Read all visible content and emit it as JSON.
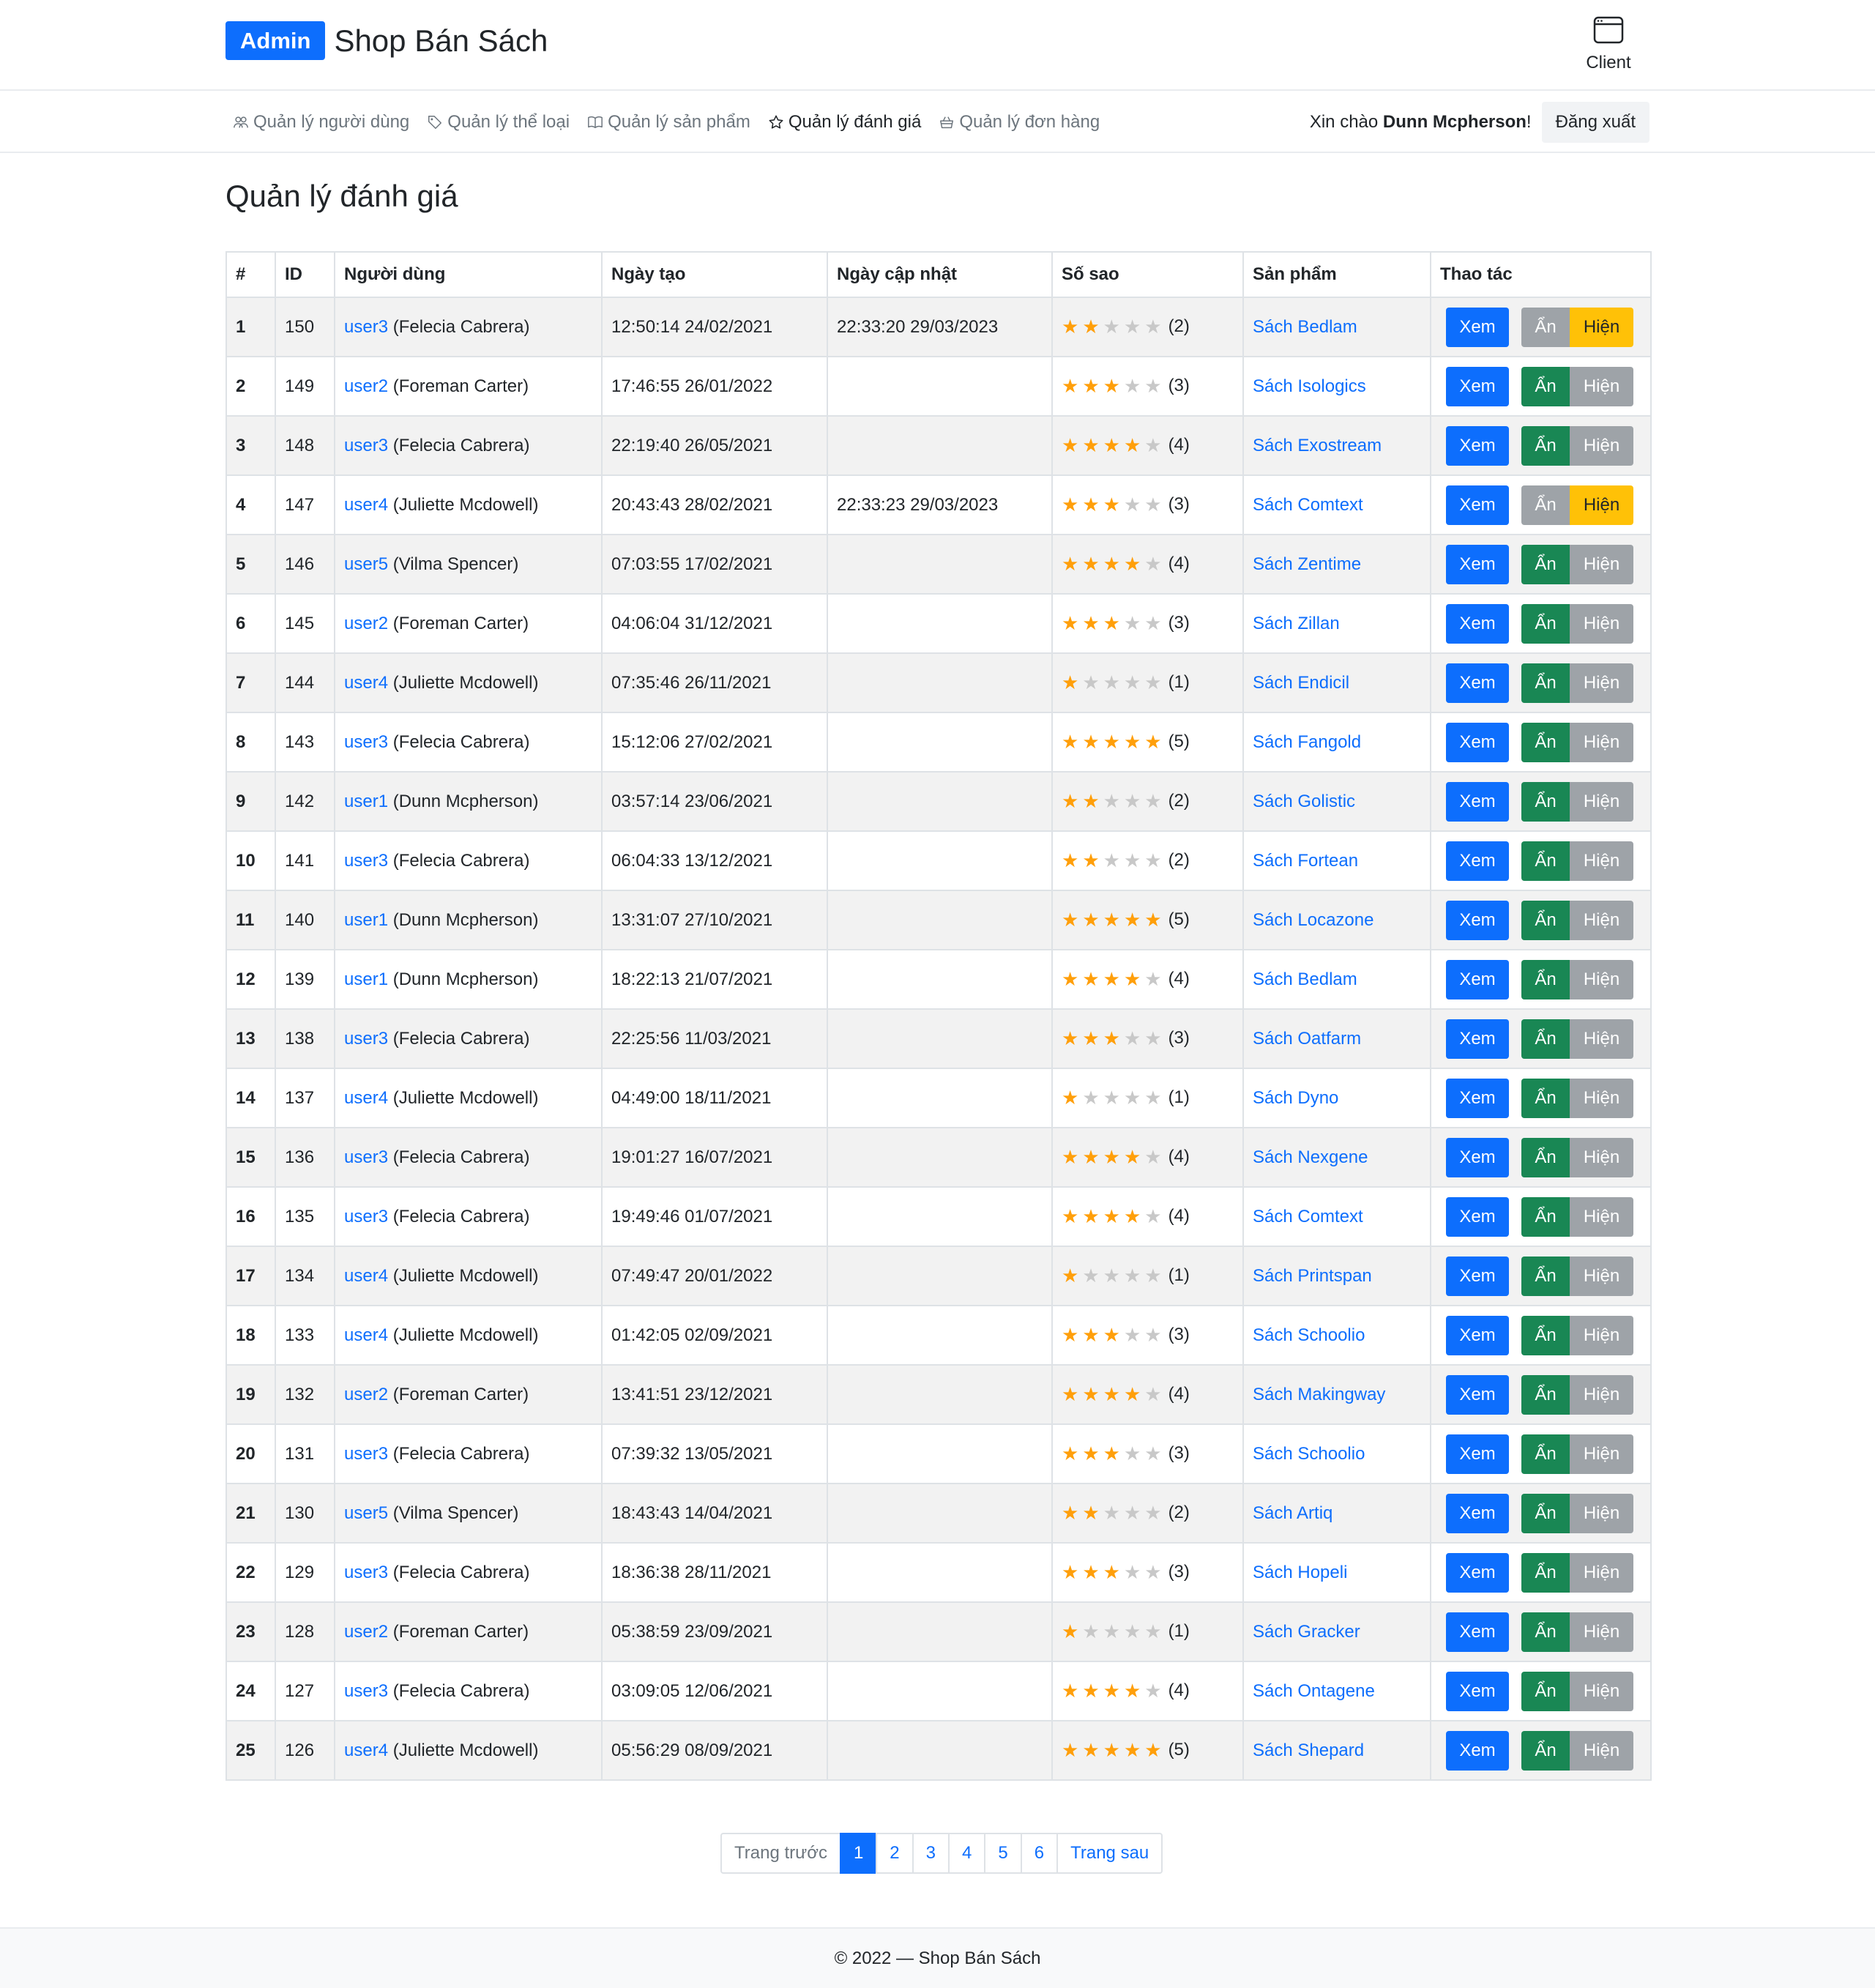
{
  "header": {
    "badge": "Admin",
    "title": "Shop Bán Sách",
    "client_label": "Client"
  },
  "nav": {
    "items": [
      {
        "label": "Quản lý người dùng",
        "icon": "people-icon",
        "active": false
      },
      {
        "label": "Quản lý thể loại",
        "icon": "tag-icon",
        "active": false
      },
      {
        "label": "Quản lý sản phẩm",
        "icon": "book-icon",
        "active": false
      },
      {
        "label": "Quản lý đánh giá",
        "icon": "star-icon",
        "active": true
      },
      {
        "label": "Quản lý đơn hàng",
        "icon": "basket-icon",
        "active": false
      }
    ],
    "greeting_prefix": "Xin chào ",
    "user_name": "Dunn Mcpherson",
    "greeting_suffix": "!",
    "logout": "Đăng xuất"
  },
  "page_title": "Quản lý đánh giá",
  "table": {
    "headers": [
      "#",
      "ID",
      "Người dùng",
      "Ngày tạo",
      "Ngày cập nhật",
      "Số sao",
      "Sản phẩm",
      "Thao tác"
    ],
    "view_label": "Xem",
    "hide_label": "Ẩn",
    "show_label": "Hiện",
    "rows": [
      {
        "idx": "1",
        "id": "150",
        "username": "user3",
        "fullname": " (Felecia Cabrera)",
        "created": "12:50:14 24/02/2021",
        "updated": "22:33:20 29/03/2023",
        "stars": 2,
        "stars_text": "(2)",
        "product": "Sách Bedlam",
        "hidden": true
      },
      {
        "idx": "2",
        "id": "149",
        "username": "user2",
        "fullname": " (Foreman Carter)",
        "created": "17:46:55 26/01/2022",
        "updated": "",
        "stars": 3,
        "stars_text": "(3)",
        "product": "Sách Isologics",
        "hidden": false
      },
      {
        "idx": "3",
        "id": "148",
        "username": "user3",
        "fullname": " (Felecia Cabrera)",
        "created": "22:19:40 26/05/2021",
        "updated": "",
        "stars": 4,
        "stars_text": "(4)",
        "product": "Sách Exostream",
        "hidden": false
      },
      {
        "idx": "4",
        "id": "147",
        "username": "user4",
        "fullname": " (Juliette Mcdowell)",
        "created": "20:43:43 28/02/2021",
        "updated": "22:33:23 29/03/2023",
        "stars": 3,
        "stars_text": "(3)",
        "product": "Sách Comtext",
        "hidden": true
      },
      {
        "idx": "5",
        "id": "146",
        "username": "user5",
        "fullname": " (Vilma Spencer)",
        "created": "07:03:55 17/02/2021",
        "updated": "",
        "stars": 4,
        "stars_text": "(4)",
        "product": "Sách Zentime",
        "hidden": false
      },
      {
        "idx": "6",
        "id": "145",
        "username": "user2",
        "fullname": " (Foreman Carter)",
        "created": "04:06:04 31/12/2021",
        "updated": "",
        "stars": 3,
        "stars_text": "(3)",
        "product": "Sách Zillan",
        "hidden": false
      },
      {
        "idx": "7",
        "id": "144",
        "username": "user4",
        "fullname": " (Juliette Mcdowell)",
        "created": "07:35:46 26/11/2021",
        "updated": "",
        "stars": 1,
        "stars_text": "(1)",
        "product": "Sách Endicil",
        "hidden": false
      },
      {
        "idx": "8",
        "id": "143",
        "username": "user3",
        "fullname": " (Felecia Cabrera)",
        "created": "15:12:06 27/02/2021",
        "updated": "",
        "stars": 5,
        "stars_text": "(5)",
        "product": "Sách Fangold",
        "hidden": false
      },
      {
        "idx": "9",
        "id": "142",
        "username": "user1",
        "fullname": " (Dunn Mcpherson)",
        "created": "03:57:14 23/06/2021",
        "updated": "",
        "stars": 2,
        "stars_text": "(2)",
        "product": "Sách Golistic",
        "hidden": false
      },
      {
        "idx": "10",
        "id": "141",
        "username": "user3",
        "fullname": " (Felecia Cabrera)",
        "created": "06:04:33 13/12/2021",
        "updated": "",
        "stars": 2,
        "stars_text": "(2)",
        "product": "Sách Fortean",
        "hidden": false
      },
      {
        "idx": "11",
        "id": "140",
        "username": "user1",
        "fullname": " (Dunn Mcpherson)",
        "created": "13:31:07 27/10/2021",
        "updated": "",
        "stars": 5,
        "stars_text": "(5)",
        "product": "Sách Locazone",
        "hidden": false
      },
      {
        "idx": "12",
        "id": "139",
        "username": "user1",
        "fullname": " (Dunn Mcpherson)",
        "created": "18:22:13 21/07/2021",
        "updated": "",
        "stars": 4,
        "stars_text": "(4)",
        "product": "Sách Bedlam",
        "hidden": false
      },
      {
        "idx": "13",
        "id": "138",
        "username": "user3",
        "fullname": " (Felecia Cabrera)",
        "created": "22:25:56 11/03/2021",
        "updated": "",
        "stars": 3,
        "stars_text": "(3)",
        "product": "Sách Oatfarm",
        "hidden": false
      },
      {
        "idx": "14",
        "id": "137",
        "username": "user4",
        "fullname": " (Juliette Mcdowell)",
        "created": "04:49:00 18/11/2021",
        "updated": "",
        "stars": 1,
        "stars_text": "(1)",
        "product": "Sách Dyno",
        "hidden": false
      },
      {
        "idx": "15",
        "id": "136",
        "username": "user3",
        "fullname": " (Felecia Cabrera)",
        "created": "19:01:27 16/07/2021",
        "updated": "",
        "stars": 4,
        "stars_text": "(4)",
        "product": "Sách Nexgene",
        "hidden": false
      },
      {
        "idx": "16",
        "id": "135",
        "username": "user3",
        "fullname": " (Felecia Cabrera)",
        "created": "19:49:46 01/07/2021",
        "updated": "",
        "stars": 4,
        "stars_text": "(4)",
        "product": "Sách Comtext",
        "hidden": false
      },
      {
        "idx": "17",
        "id": "134",
        "username": "user4",
        "fullname": " (Juliette Mcdowell)",
        "created": "07:49:47 20/01/2022",
        "updated": "",
        "stars": 1,
        "stars_text": "(1)",
        "product": "Sách Printspan",
        "hidden": false
      },
      {
        "idx": "18",
        "id": "133",
        "username": "user4",
        "fullname": " (Juliette Mcdowell)",
        "created": "01:42:05 02/09/2021",
        "updated": "",
        "stars": 3,
        "stars_text": "(3)",
        "product": "Sách Schoolio",
        "hidden": false
      },
      {
        "idx": "19",
        "id": "132",
        "username": "user2",
        "fullname": " (Foreman Carter)",
        "created": "13:41:51 23/12/2021",
        "updated": "",
        "stars": 4,
        "stars_text": "(4)",
        "product": "Sách Makingway",
        "hidden": false
      },
      {
        "idx": "20",
        "id": "131",
        "username": "user3",
        "fullname": " (Felecia Cabrera)",
        "created": "07:39:32 13/05/2021",
        "updated": "",
        "stars": 3,
        "stars_text": "(3)",
        "product": "Sách Schoolio",
        "hidden": false
      },
      {
        "idx": "21",
        "id": "130",
        "username": "user5",
        "fullname": " (Vilma Spencer)",
        "created": "18:43:43 14/04/2021",
        "updated": "",
        "stars": 2,
        "stars_text": "(2)",
        "product": "Sách Artiq",
        "hidden": false
      },
      {
        "idx": "22",
        "id": "129",
        "username": "user3",
        "fullname": " (Felecia Cabrera)",
        "created": "18:36:38 28/11/2021",
        "updated": "",
        "stars": 3,
        "stars_text": "(3)",
        "product": "Sách Hopeli",
        "hidden": false
      },
      {
        "idx": "23",
        "id": "128",
        "username": "user2",
        "fullname": " (Foreman Carter)",
        "created": "05:38:59 23/09/2021",
        "updated": "",
        "stars": 1,
        "stars_text": "(1)",
        "product": "Sách Gracker",
        "hidden": false
      },
      {
        "idx": "24",
        "id": "127",
        "username": "user3",
        "fullname": " (Felecia Cabrera)",
        "created": "03:09:05 12/06/2021",
        "updated": "",
        "stars": 4,
        "stars_text": "(4)",
        "product": "Sách Ontagene",
        "hidden": false
      },
      {
        "idx": "25",
        "id": "126",
        "username": "user4",
        "fullname": " (Juliette Mcdowell)",
        "created": "05:56:29 08/09/2021",
        "updated": "",
        "stars": 5,
        "stars_text": "(5)",
        "product": "Sách Shepard",
        "hidden": false
      }
    ]
  },
  "pagination": {
    "prev": "Trang trước",
    "pages": [
      "1",
      "2",
      "3",
      "4",
      "5",
      "6"
    ],
    "current": "1",
    "next": "Trang sau"
  },
  "footer": {
    "text": "© 2022 — Shop Bán Sách"
  },
  "colors": {
    "primary": "#0d6efd",
    "success": "#198754",
    "warning": "#ffc107",
    "secondary": "#9ea3a8",
    "star": "#ff9f0a"
  }
}
